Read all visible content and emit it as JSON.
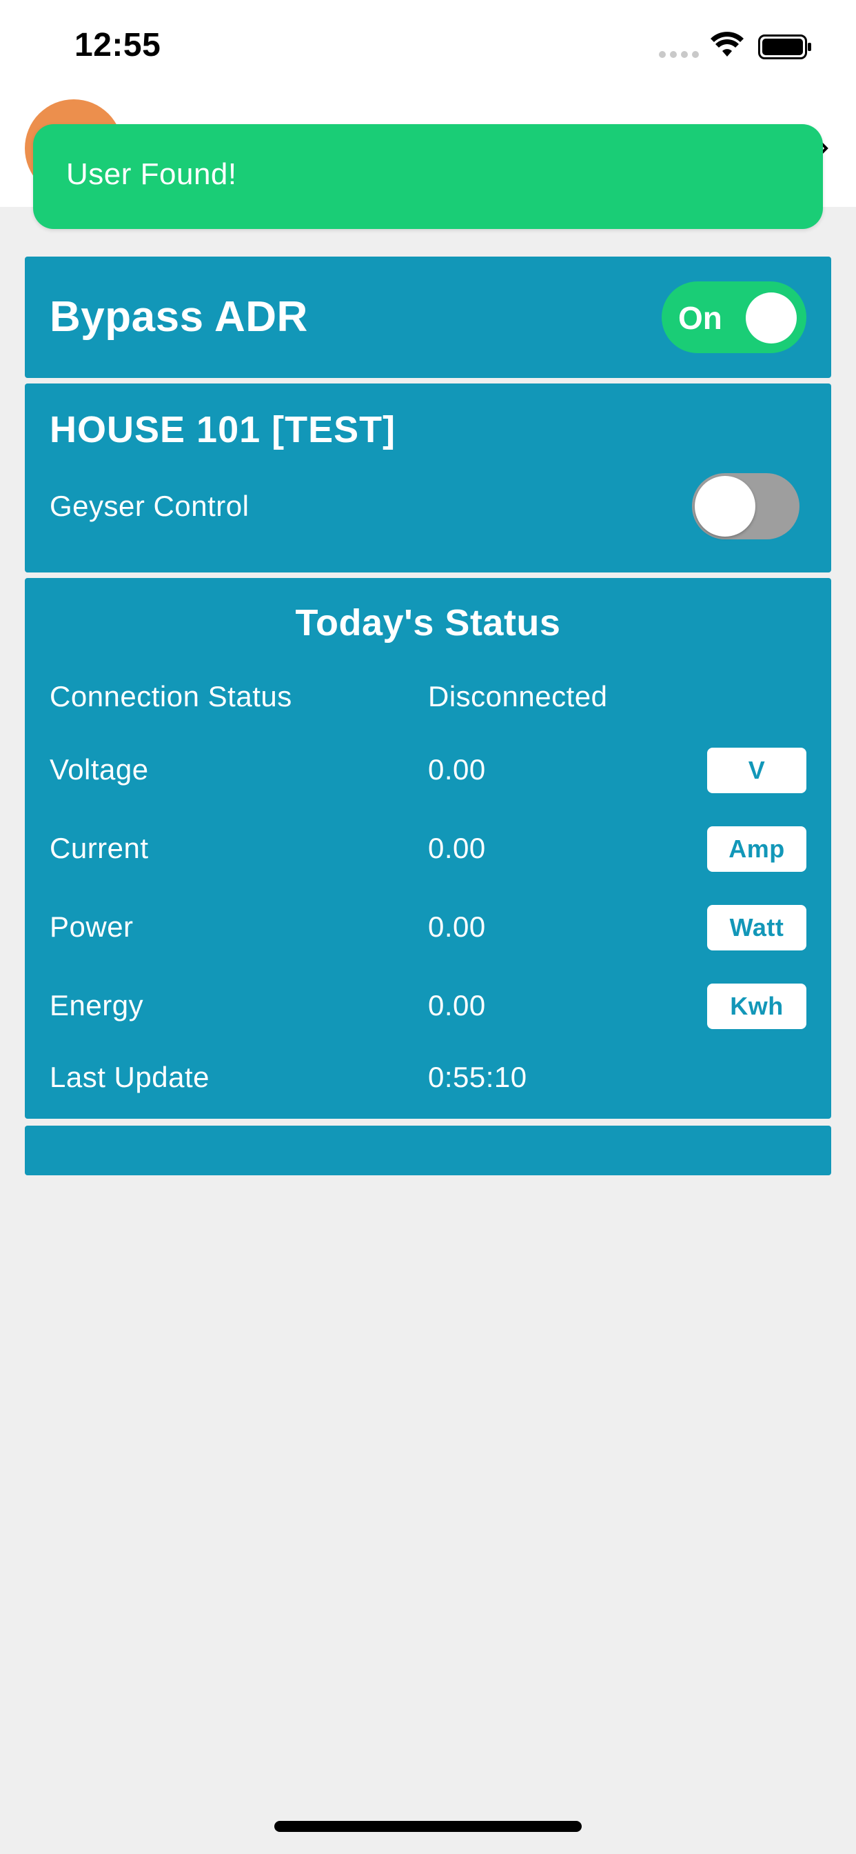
{
  "status_bar": {
    "time": "12:55",
    "icons": [
      "signal-dots-icon",
      "wifi-icon",
      "battery-icon"
    ]
  },
  "toast": {
    "message": "User Found!",
    "color": "#1acd76"
  },
  "bypass": {
    "title": "Bypass ADR",
    "toggle_label": "On",
    "toggle_state": "on"
  },
  "house": {
    "title": "HOUSE 101 [TEST]",
    "geyser_label": "Geyser Control",
    "geyser_state": "off"
  },
  "status": {
    "title": "Today's Status",
    "rows": [
      {
        "label": "Connection Status",
        "value": "Disconnected",
        "unit": ""
      },
      {
        "label": "Voltage",
        "value": "0.00",
        "unit": "V"
      },
      {
        "label": "Current",
        "value": "0.00",
        "unit": "Amp"
      },
      {
        "label": "Power",
        "value": "0.00",
        "unit": "Watt"
      },
      {
        "label": "Energy",
        "value": "0.00",
        "unit": "Kwh"
      },
      {
        "label": "Last Update",
        "value": "0:55:10",
        "unit": ""
      }
    ]
  },
  "colors": {
    "card": "#1297b8",
    "toggle_on": "#1acd76",
    "toggle_off": "#9e9e9e",
    "avatar": "#ec8f4d",
    "background": "#efefef"
  }
}
